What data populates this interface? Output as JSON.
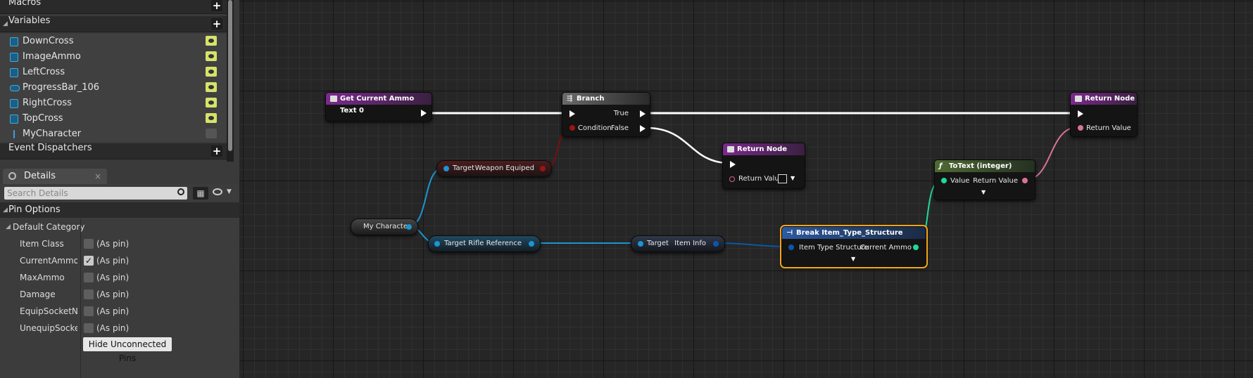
{
  "my_blueprint": {
    "sections": {
      "macros": "Macros",
      "variables": "Variables",
      "event_dispatchers": "Event Dispatchers"
    },
    "variables": [
      {
        "name": "DownCross",
        "icon": "widget-var-icon"
      },
      {
        "name": "ImageAmmo",
        "icon": "widget-var-icon"
      },
      {
        "name": "LeftCross",
        "icon": "widget-var-icon"
      },
      {
        "name": "ProgressBar_106",
        "icon": "progressbar-var-icon"
      },
      {
        "name": "RightCross",
        "icon": "widget-var-icon"
      },
      {
        "name": "TopCross",
        "icon": "widget-var-icon"
      },
      {
        "name": "MyCharacter",
        "icon": "character-var-icon"
      }
    ],
    "add_symbol": "+"
  },
  "details": {
    "tab_label": "Details",
    "close_glyph": "×",
    "search_placeholder": "Search Details",
    "pin_options_label": "Pin Options",
    "default_category_label": "Default Category",
    "pins": [
      {
        "name": "Item Class",
        "checked": false,
        "value": "(As pin)"
      },
      {
        "name": "CurrentAmmo",
        "checked": true,
        "value": "(As pin)"
      },
      {
        "name": "MaxAmmo",
        "checked": false,
        "value": "(As pin)"
      },
      {
        "name": "Damage",
        "checked": false,
        "value": "(As pin)"
      },
      {
        "name": "EquipSocketName",
        "checked": false,
        "value": "(As pin)"
      },
      {
        "name": "UnequipSocketName",
        "checked": false,
        "value": "(As pin)"
      }
    ],
    "hide_button": "Hide Unconnected Pins",
    "check_glyph": "✓"
  },
  "graph": {
    "nodes": {
      "get_ammo": {
        "title": "Get Current Ammo Text 0"
      },
      "branch": {
        "title": "Branch",
        "condition": "Condition",
        "true_label": "True",
        "false_label": "False"
      },
      "return1": {
        "title": "Return Node",
        "return_value": "Return Value"
      },
      "return2": {
        "title": "Return Node",
        "return_value": "Return Value"
      },
      "totext": {
        "title": "ToText (integer)",
        "value": "Value",
        "return_value": "Return Value"
      },
      "break_struct": {
        "title": "Break Item_Type_Structure",
        "input": "Item Type Structure",
        "output": "Current Ammo"
      },
      "weapon_equiped": {
        "target": "Target",
        "output": "Weapon Equiped"
      },
      "rifle_reference": {
        "target": "Target",
        "output": "Rifle Reference"
      },
      "item_info": {
        "target": "Target",
        "output": "Item Info"
      },
      "my_character": {
        "label": "My Character"
      }
    },
    "colors": {
      "exec_wire": "#ffffff",
      "bool_wire": "#7a0f0f",
      "object_wire": "#1c95d0",
      "struct_wire": "#0a58a8",
      "int_wire": "#1fd8a0",
      "text_wire": "#d8729a",
      "selection": "#f3a51a"
    }
  }
}
